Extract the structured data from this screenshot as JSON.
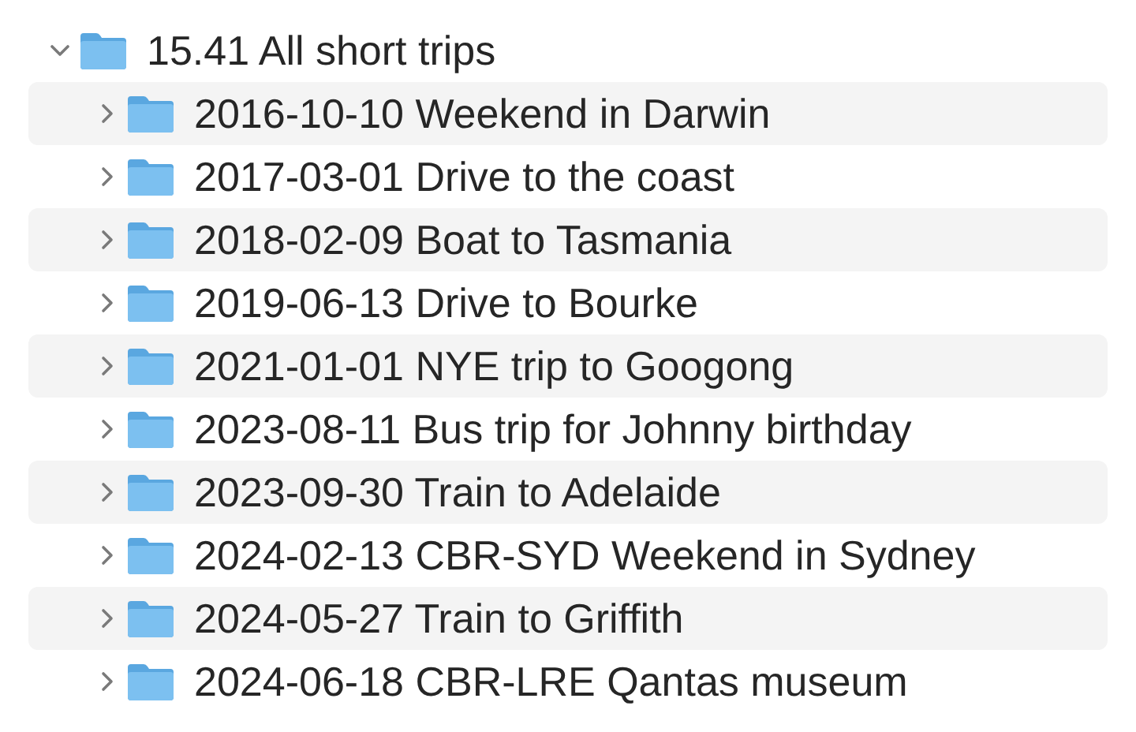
{
  "tree": [
    {
      "label": "15.41 All short trips",
      "expanded": true,
      "children": [
        {
          "label": "2016-10-10 Weekend in Darwin",
          "expanded": false
        },
        {
          "label": "2017-03-01 Drive to the coast",
          "expanded": false
        },
        {
          "label": "2018-02-09 Boat to Tasmania",
          "expanded": false
        },
        {
          "label": "2019-06-13 Drive to Bourke",
          "expanded": false
        },
        {
          "label": "2021-01-01 NYE trip to Googong",
          "expanded": false
        },
        {
          "label": "2023-08-11 Bus trip for Johnny birthday",
          "expanded": false
        },
        {
          "label": "2023-09-30 Train to Adelaide",
          "expanded": false
        },
        {
          "label": "2024-02-13 CBR-SYD Weekend in Sydney",
          "expanded": false
        },
        {
          "label": "2024-05-27 Train to Griffith",
          "expanded": false
        },
        {
          "label": "2024-06-18 CBR-LRE Qantas museum",
          "expanded": false
        }
      ]
    }
  ]
}
